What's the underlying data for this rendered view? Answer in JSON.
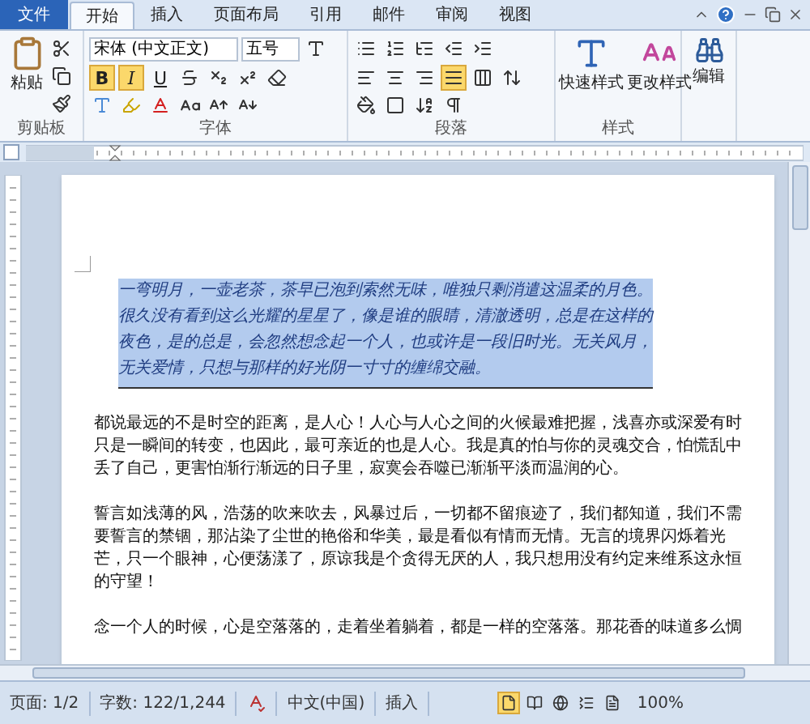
{
  "tabs": [
    {
      "label": "文件",
      "kind": "file",
      "selected": false
    },
    {
      "label": "开始",
      "kind": "tab",
      "selected": true
    },
    {
      "label": "插入",
      "kind": "tab",
      "selected": false
    },
    {
      "label": "页面布局",
      "kind": "tab",
      "selected": false
    },
    {
      "label": "引用",
      "kind": "tab",
      "selected": false
    },
    {
      "label": "邮件",
      "kind": "tab",
      "selected": false
    },
    {
      "label": "审阅",
      "kind": "tab",
      "selected": false
    },
    {
      "label": "视图",
      "kind": "tab",
      "selected": false
    }
  ],
  "clipboard": {
    "paste": "粘贴",
    "group": "剪贴板"
  },
  "font": {
    "name": "宋体 (中文正文)",
    "size": "五号",
    "group": "字体",
    "toggles": [
      {
        "label": "B",
        "kind": "bold",
        "on": true
      },
      {
        "label": "I",
        "kind": "italic",
        "on": true
      },
      {
        "label": "U",
        "kind": "underline",
        "on": false
      }
    ]
  },
  "paragraph": {
    "group": "段落",
    "alignment": [
      {
        "kind": "left",
        "selected": false
      },
      {
        "kind": "center",
        "selected": false
      },
      {
        "kind": "right",
        "selected": false
      },
      {
        "kind": "justify",
        "selected": true
      },
      {
        "kind": "distributed",
        "selected": false
      }
    ]
  },
  "styles": {
    "quick": "快速样式",
    "change": "更改样式",
    "group": "样式"
  },
  "editing": {
    "label": "编辑"
  },
  "document": {
    "selected_paragraph": "一弯明月，一壶老茶，茶早已泡到索然无味，唯独只剩消遣这温柔的月色。很久没有看到这么光耀的星星了，像是谁的眼睛，清澈透明，总是在这样的夜色，是的总是，会忽然想念起一个人，也或许是一段旧时光。无关风月，无关爱情，只想与那样的好光阴一寸寸的缠绵交融。",
    "paragraphs": [
      "都说最远的不是时空的距离，是人心！人心与人心之间的火候最难把握，浅喜亦或深爱有时只是一瞬间的转变，也因此，最可亲近的也是人心。我是真的怕与你的灵魂交合，怕慌乱中丢了自己，更害怕渐行渐远的日子里，寂寞会吞噬已渐渐平淡而温润的心。",
      "誓言如浅薄的风，浩荡的吹来吹去，风暴过后，一切都不留痕迹了，我们都知道，我们不需要誓言的禁锢，那沾染了尘世的艳俗和华美，最是看似有情而无情。无言的境界闪烁着光芒，只一个眼神，心便荡漾了，原谅我是个贪得无厌的人，我只想用没有约定来维系这永恒的守望！",
      "念一个人的时候，心是空落落的，走着坐着躺着，都是一样的空落落。那花香的味道多么惆"
    ]
  },
  "status_bar": {
    "page": "页面: 1/2",
    "words": "字数: 122/1,244",
    "language": "中文(中国)",
    "mode": "插入",
    "zoom": "100%",
    "views": [
      {
        "kind": "print",
        "selected": true
      },
      {
        "kind": "reading",
        "selected": false
      },
      {
        "kind": "web",
        "selected": false
      },
      {
        "kind": "outline",
        "selected": false
      },
      {
        "kind": "draft",
        "selected": false
      }
    ]
  }
}
